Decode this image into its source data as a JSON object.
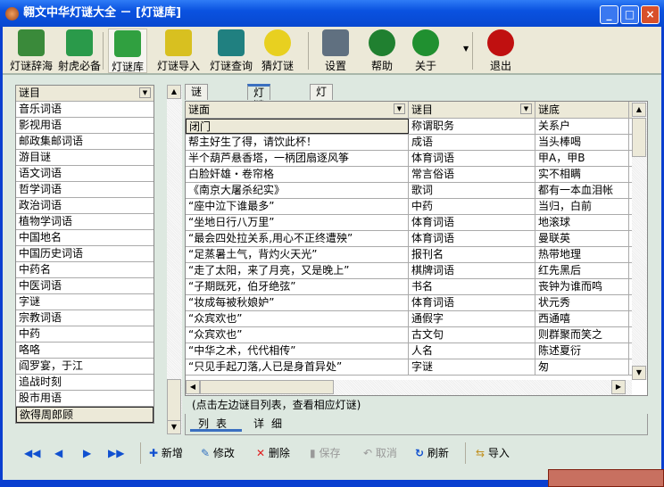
{
  "window": {
    "title": "翱文中华灯谜大全 － [灯谜库]",
    "min": "_",
    "max": "□",
    "close": "×"
  },
  "toolbar": [
    {
      "label": "灯谜辞海",
      "icon": "dictionary-icon",
      "color": "#3a8a3a"
    },
    {
      "label": "射虎必备",
      "icon": "briefcase-icon",
      "color": "#2a9a4a"
    },
    {
      "label": "灯谜库",
      "icon": "globe-folder-icon",
      "color": "#30a040"
    },
    {
      "label": "灯谜导入",
      "icon": "database-import-icon",
      "color": "#d8c020"
    },
    {
      "label": "灯谜查询",
      "icon": "magnifier-icon",
      "color": "#208080"
    },
    {
      "label": "猜灯谜",
      "icon": "smiley-icon",
      "color": "#e8d020"
    },
    {
      "label": "设置",
      "icon": "gear-icon",
      "color": "#607080"
    },
    {
      "label": "帮助",
      "icon": "help-icon",
      "color": "#208030"
    },
    {
      "label": "关于",
      "icon": "info-icon",
      "color": "#209030"
    },
    {
      "label": "退出",
      "icon": "power-icon",
      "color": "#c01010"
    }
  ],
  "left": {
    "header": "谜目",
    "items": [
      "音乐词语",
      "影视用语",
      "邮政集邮词语",
      "游目谜",
      "语文词语",
      "哲学词语",
      "政治词语",
      "植物学词语",
      "中国地名",
      "中国历史词语",
      "中药名",
      "中医词语",
      "字谜",
      "宗教词语",
      "中药",
      "咯咯",
      "阎罗宴，于江",
      "追战时刻",
      "股市用语",
      "欲得周郎顾"
    ]
  },
  "tabs": [
    "谜目管理",
    "灯谜管理",
    "灯谜查询"
  ],
  "grid": {
    "headers": [
      "谜面",
      "谜目",
      "谜底"
    ],
    "rows": [
      [
        "闭门",
        "称谓职务",
        "关系户"
      ],
      [
        "帮主好生了得，请饮此杯！",
        "成语",
        "当头棒喝"
      ],
      [
        "半个葫芦悬香塔，一柄团扇逐风筝",
        "体育词语",
        "甲A，甲B"
      ],
      [
        "白脸奸雄・卷帘格",
        "常言俗语",
        "实不相瞒"
      ],
      [
        "《南京大屠杀纪实》",
        "歌词",
        "都有一本血泪帐"
      ],
      [
        "“座中泣下谁最多”",
        "中药",
        "当归，白前"
      ],
      [
        "“坐地日行八万里”",
        "体育词语",
        "地滚球"
      ],
      [
        "“最会四处拉关系,用心不正终遭殃”",
        "体育词语",
        "曼联英"
      ],
      [
        "“足蒸暑土气，背灼火天光”",
        "报刊名",
        "热带地理"
      ],
      [
        "“走了太阳，来了月亮，又是晚上”",
        "棋牌词语",
        "红先黑后"
      ],
      [
        "“子期既死，伯牙绝弦”",
        "书名",
        "丧钟为谁而鸣"
      ],
      [
        "“妆成每被秋娘妒”",
        "体育词语",
        "状元秀"
      ],
      [
        "“众宾欢也”",
        "通假字",
        "西通嘻"
      ],
      [
        "“众宾欢也”",
        "古文句",
        "则群聚而笑之"
      ],
      [
        "“中华之术，代代相传”",
        "人名",
        "陈述夏衍"
      ],
      [
        "“只见手起刀落,人已是身首异处”",
        "字谜",
        "匆"
      ]
    ]
  },
  "status": "(点击左边谜目列表，查看相应灯谜)",
  "bottom_tabs": [
    "列表",
    "详细"
  ],
  "bottom": {
    "new": "新增",
    "edit": "修改",
    "delete": "删除",
    "save": "保存",
    "cancel": "取消",
    "refresh": "刷新",
    "import": "导入"
  }
}
